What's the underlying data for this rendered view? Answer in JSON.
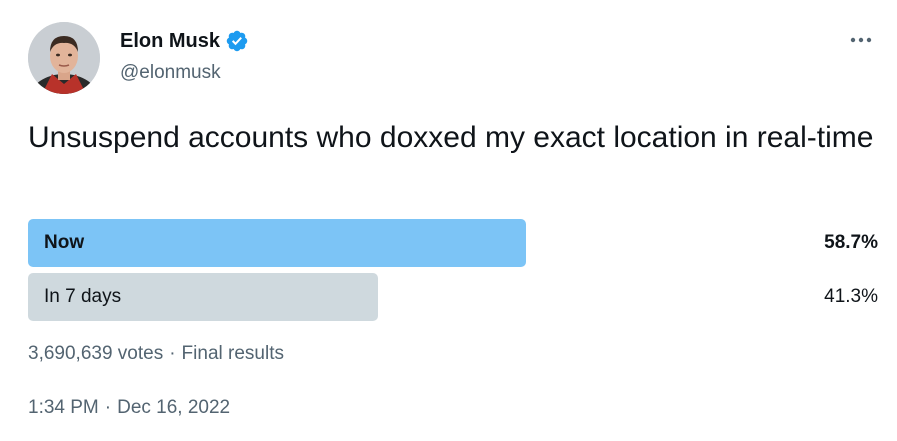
{
  "author": {
    "display_name": "Elon Musk",
    "handle": "@elonmusk",
    "verified": true,
    "avatar_icon": "avatar-photo",
    "verified_icon": "verified-badge-icon"
  },
  "more_icon": "more-options-icon",
  "tweet": {
    "text": "Unsuspend accounts who doxxed my exact location in real-time"
  },
  "poll": {
    "options": [
      {
        "label": "Now",
        "percent_text": "58.7%",
        "percent": 58.7,
        "winner": true,
        "bar_color": "#7cc4f6"
      },
      {
        "label": "In 7 days",
        "percent_text": "41.3%",
        "percent": 41.3,
        "winner": false,
        "bar_color": "#cfd9de"
      }
    ],
    "votes": "3,690,639 votes",
    "separator": "·",
    "status": "Final results"
  },
  "timestamp": {
    "time": "1:34 PM",
    "separator": "·",
    "date": "Dec 16, 2022"
  },
  "colors": {
    "text_primary": "#0f1419",
    "text_secondary": "#536471",
    "verified_blue": "#1d9bf0"
  }
}
